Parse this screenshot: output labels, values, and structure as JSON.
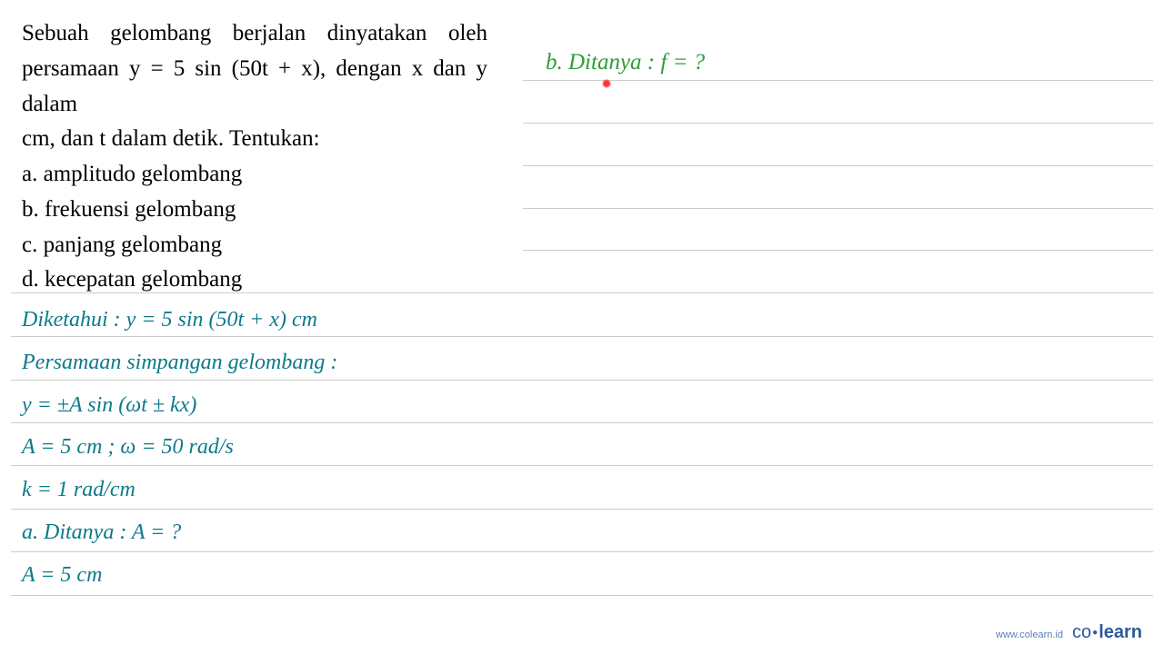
{
  "problem": {
    "intro_line1": "Sebuah   gelombang   berjalan   dinyatakan   oleh",
    "intro_line2": "persamaan y = 5 sin (50t + x), dengan x dan y dalam",
    "intro_line3": "cm, dan t dalam detik. Tentukan:",
    "items": [
      "a. amplitudo gelombang",
      "b. frekuensi gelombang",
      "c. panjang gelombang",
      "d. kecepatan gelombang"
    ]
  },
  "answers": {
    "lines": [
      "Diketahui : y = 5 sin (50t + x) cm",
      "Persamaan simpangan gelombang :",
      "y = ±A sin (ωt ± kx)",
      "A = 5 cm ; ω = 50 rad/s",
      "k = 1 rad/cm",
      "a. Ditanya : A = ?",
      "A = 5 cm"
    ]
  },
  "green_annotation": "b. Ditanya : f = ?",
  "footer": {
    "url": "www.colearn.id",
    "brand_co": "co",
    "brand_learn": "learn"
  },
  "rule_positions": {
    "partial": [
      88,
      135,
      182,
      229,
      275
    ],
    "full": [
      322,
      370,
      418,
      465,
      512,
      560,
      607,
      655
    ]
  }
}
